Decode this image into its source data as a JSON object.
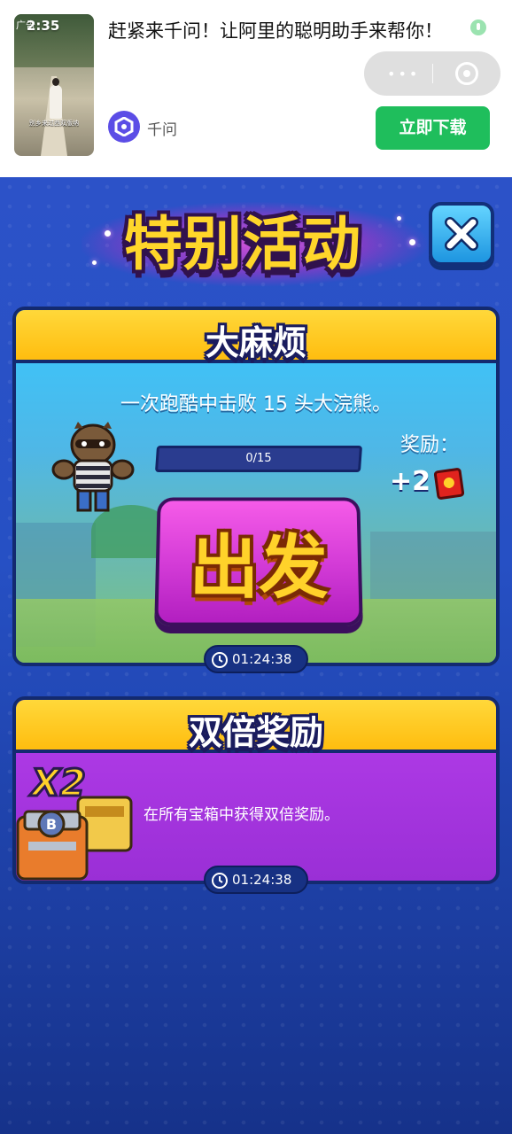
{
  "ad": {
    "badge": "广告",
    "timer": "2:35",
    "thumbnail_caption": "别乡来过西双版纳",
    "title": "赶紧来千问！让阿里的聪明助手来帮你！",
    "brand_name": "千问",
    "download_label": "立即下载",
    "capsule_menu": "•••"
  },
  "header": {
    "title": "特别活动"
  },
  "event_card": {
    "title": "大麻烦",
    "description": "一次跑酷中击败 15 头大浣熊。",
    "progress_text": "0/15",
    "progress_value": 0,
    "reward_label": "奖励：",
    "reward_value": "+2",
    "go_label": "出发",
    "timer": "01:24:38"
  },
  "double_card": {
    "title": "双倍奖励",
    "multiplier": "X2",
    "description": "在所有宝箱中获得双倍奖励。",
    "timer": "01:24:38"
  },
  "colors": {
    "title_yellow": "#ffd62a",
    "card_head": "#ffc81f",
    "go_button": "#d23ad6",
    "download_green": "#1fbe5c",
    "background_blue": "#2650c4"
  }
}
